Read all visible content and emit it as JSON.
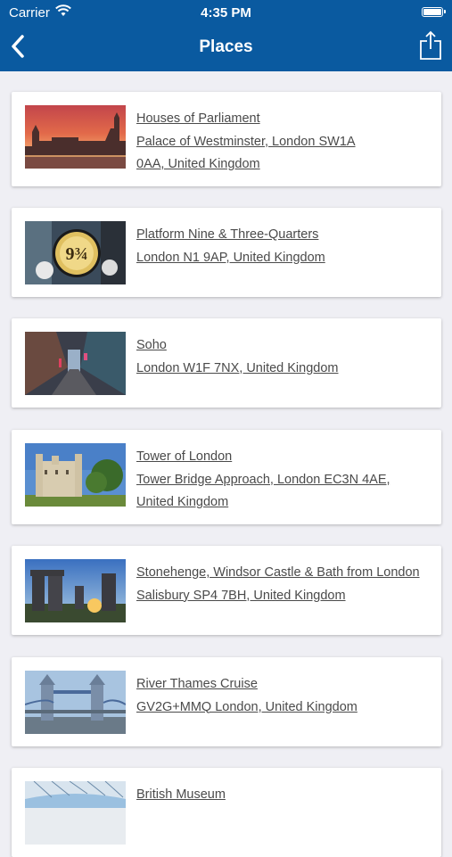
{
  "status_bar": {
    "carrier": "Carrier",
    "time": "4:35 PM"
  },
  "nav": {
    "title": "Places",
    "back_icon": "chevron-left-icon",
    "share_icon": "share-icon",
    "bar_color": "#0a5aa0"
  },
  "places": [
    {
      "name": "Houses of Parliament",
      "address_line1": "Palace of Westminster, London SW1A",
      "address_line2": "0AA, United Kingdom"
    },
    {
      "name": "Platform Nine & Three-Quarters",
      "address_line1": "London N1 9AP, United Kingdom"
    },
    {
      "name": "Soho",
      "address_line1": "London W1F 7NX, United Kingdom"
    },
    {
      "name": "Tower of London",
      "address_line1": "Tower Bridge Approach, London EC3N 4AE,",
      "address_line2": "United Kingdom"
    },
    {
      "name": "Stonehenge, Windsor Castle & Bath from London",
      "address_line1": "Salisbury SP4 7BH, United Kingdom"
    },
    {
      "name": "River Thames Cruise",
      "address_line1": "GV2G+MMQ London, United Kingdom"
    },
    {
      "name": "British Museum"
    }
  ]
}
